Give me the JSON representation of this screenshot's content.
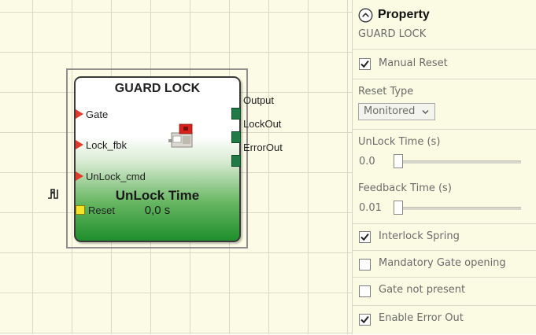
{
  "block": {
    "title": "GUARD LOCK",
    "inputs": [
      "Gate",
      "Lock_fbk",
      "UnLock_cmd"
    ],
    "reset_label": "Reset",
    "outputs": [
      "Output",
      "LockOut",
      "ErrorOut"
    ],
    "param_name": "UnLock Time",
    "param_value": "0,0 s"
  },
  "panel": {
    "header": "Property",
    "subtitle": "GUARD LOCK",
    "manual_reset": {
      "label": "Manual Reset",
      "checked": true
    },
    "reset_type": {
      "label": "Reset Type",
      "value": "Monitored"
    },
    "unlock_time": {
      "label": "UnLock Time (s)",
      "value": "0.0"
    },
    "feedback_time": {
      "label": "Feedback Time (s)",
      "value": "0.01"
    },
    "interlock_spring": {
      "label": "Interlock Spring",
      "checked": true
    },
    "mandatory_gate": {
      "label": "Mandatory Gate opening",
      "checked": false
    },
    "gate_not_present": {
      "label": "Gate not present",
      "checked": false
    },
    "enable_error_out": {
      "label": "Enable Error Out",
      "checked": true
    }
  },
  "icons": {
    "pulse": "pulse-edge-icon",
    "collapse": "chevron-up-circle-icon",
    "device": "guard-lock-device-icon",
    "dropdown": "chevron-down-icon"
  },
  "colors": {
    "canvas_bg": "#fbfbe6",
    "panel_bg": "#fbfbe3",
    "block_green": "#1e8f2c",
    "input_port": "#e23b2b",
    "output_port": "#1f7a46",
    "reset_port": "#f3e42a"
  }
}
